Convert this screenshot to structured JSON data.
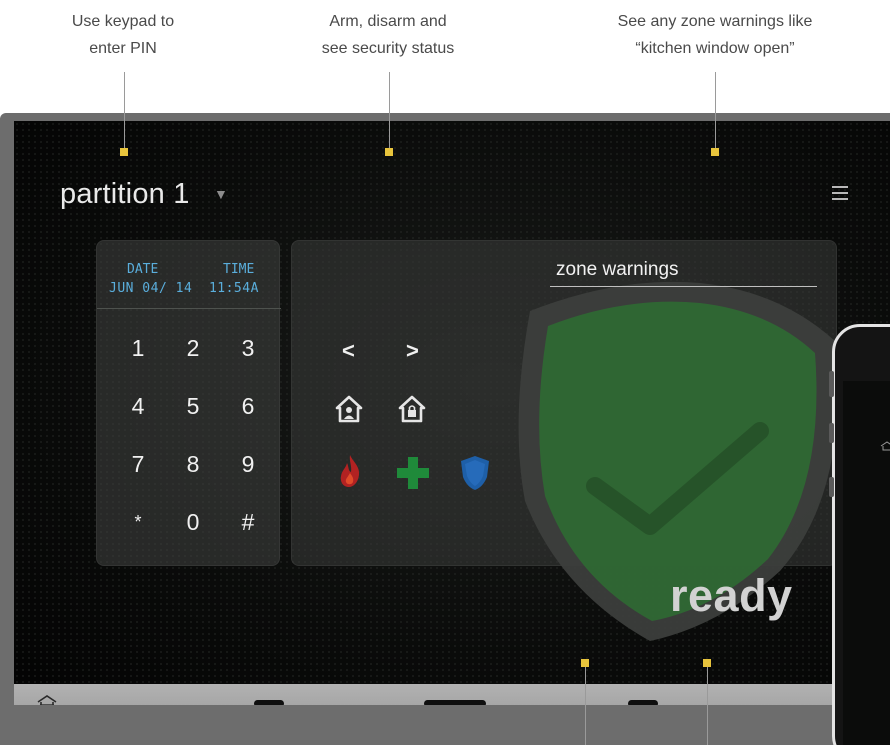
{
  "callouts": [
    {
      "line1": "Use keypad to",
      "line2": "enter PIN"
    },
    {
      "line1": "Arm, disarm and",
      "line2": "see security status"
    },
    {
      "line1": "See any zone warnings like",
      "line2": "“kitchen window open”"
    }
  ],
  "header": {
    "title": "partition 1",
    "caret": "▼"
  },
  "lcd": {
    "date_label": "DATE",
    "time_label": "TIME",
    "date_value": "JUN 04/ 14",
    "time_value": "11:54A"
  },
  "keypad": {
    "keys": [
      "1",
      "2",
      "3",
      "4",
      "5",
      "6",
      "7",
      "8",
      "9",
      "*",
      "0",
      "#"
    ]
  },
  "controls": {
    "prev": "<",
    "next": ">"
  },
  "zone_warnings": {
    "title": "zone warnings"
  },
  "status": {
    "text": "ready"
  },
  "icons": {
    "menu": "menu-icon",
    "stay_arm": "arm-stay-icon",
    "away_arm": "arm-away-icon",
    "fire": "fire-icon",
    "medical": "medical-icon",
    "police": "police-icon",
    "shield": "shield-check-icon",
    "home": "home-icon"
  },
  "colors": {
    "accent_dot": "#e8c43c",
    "lcd_text": "#5aaedc",
    "fire": "#b22222",
    "medical": "#1f8a3a",
    "police": "#1e5fa8",
    "shield": "#2f6a33"
  }
}
